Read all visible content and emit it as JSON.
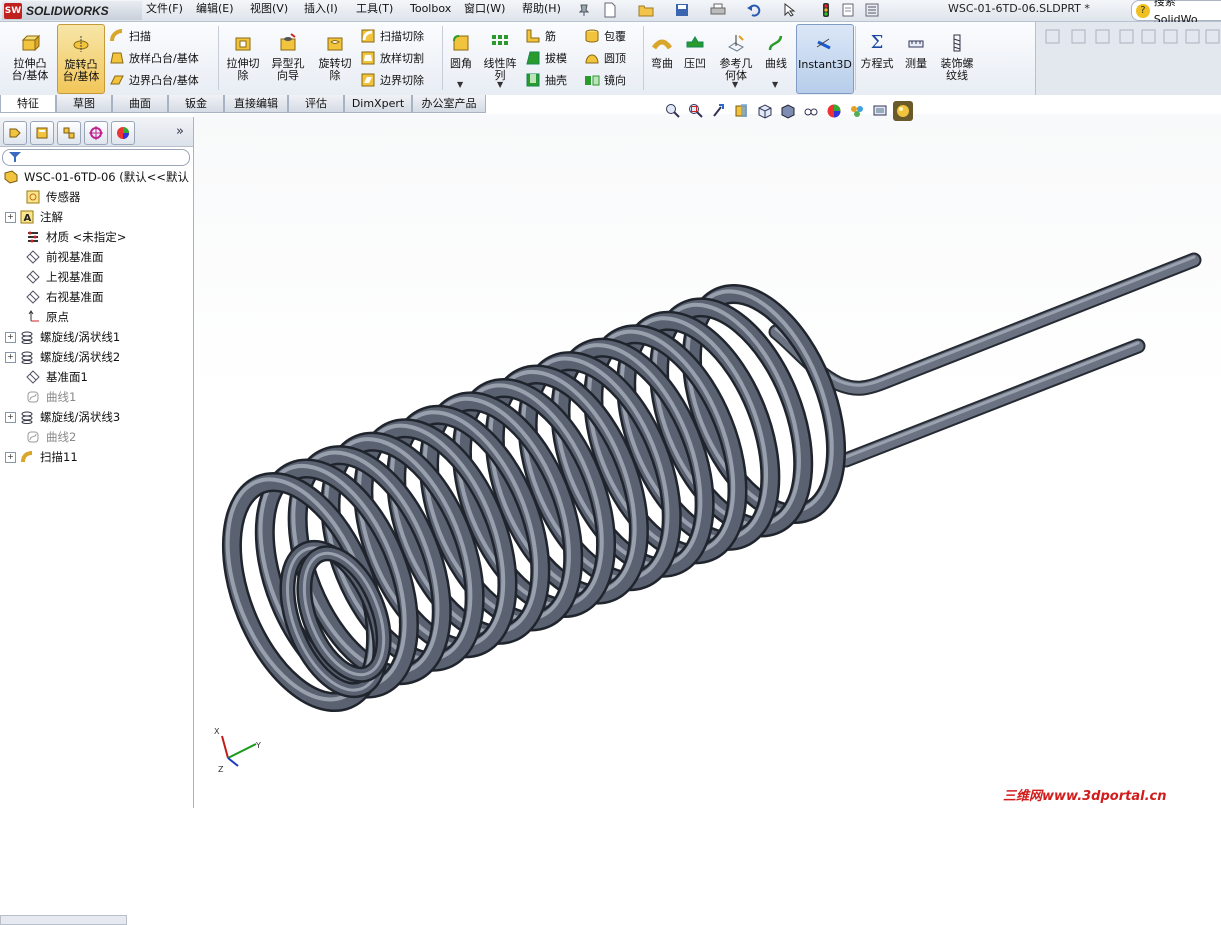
{
  "app": {
    "logo_badge": "SW",
    "logo_text": "SOLIDWORKS",
    "document_title": "WSC-01-6TD-06.SLDPRT *",
    "search_placeholder": "搜索 SolidWo"
  },
  "menubar": [
    "文件(F)",
    "编辑(E)",
    "视图(V)",
    "插入(I)",
    "工具(T)",
    "Toolbox",
    "窗口(W)",
    "帮助(H)"
  ],
  "ribbon": {
    "extrude_boss": "拉伸凸台/基体",
    "revolve_boss": "旋转凸台/基体",
    "sweep": "扫描",
    "loft_boss": "放样凸台/基体",
    "boundary_boss": "边界凸台/基体",
    "extrude_cut": "拉伸切除",
    "hole_wizard": "异型孔向导",
    "revolve_cut": "旋转切除",
    "sweep_cut": "扫描切除",
    "loft_cut": "放样切割",
    "boundary_cut": "边界切除",
    "fillet": "圆角",
    "linear_pattern": "线性阵列",
    "rib": "筋",
    "draft": "拔模",
    "shell": "抽壳",
    "wrap": "包覆",
    "dome": "圆顶",
    "mirror": "镜向",
    "flex": "弯曲",
    "indent": "压凹",
    "ref_geometry": "参考几何体",
    "curves": "曲线",
    "instant3d": "Instant3D",
    "equations": "方程式",
    "measure": "测量",
    "cosmetic_thread": "装饰螺纹线"
  },
  "tabs": [
    "特征",
    "草图",
    "曲面",
    "钣金",
    "直接编辑",
    "评估",
    "DimXpert",
    "办公室产品"
  ],
  "active_tab": "特征",
  "feature_tree": {
    "root": "WSC-01-6TD-06 (默认<<默认",
    "items": [
      {
        "label": "传感器",
        "icon": "sensor-icon",
        "expandable": false,
        "dim": false
      },
      {
        "label": "注解",
        "icon": "annotation-icon",
        "expandable": true,
        "dim": false
      },
      {
        "label": "材质 <未指定>",
        "icon": "material-icon",
        "expandable": false,
        "dim": false
      },
      {
        "label": "前视基准面",
        "icon": "plane-icon",
        "expandable": false,
        "dim": false
      },
      {
        "label": "上视基准面",
        "icon": "plane-icon",
        "expandable": false,
        "dim": false
      },
      {
        "label": "右视基准面",
        "icon": "plane-icon",
        "expandable": false,
        "dim": false
      },
      {
        "label": "原点",
        "icon": "origin-icon",
        "expandable": false,
        "dim": false
      },
      {
        "label": "螺旋线/涡状线1",
        "icon": "helix-icon",
        "expandable": true,
        "dim": false
      },
      {
        "label": "螺旋线/涡状线2",
        "icon": "helix-icon",
        "expandable": true,
        "dim": false
      },
      {
        "label": "基准面1",
        "icon": "plane-icon",
        "expandable": false,
        "dim": false
      },
      {
        "label": "曲线1",
        "icon": "curve-icon",
        "expandable": false,
        "dim": true
      },
      {
        "label": "螺旋线/涡状线3",
        "icon": "helix-icon",
        "expandable": true,
        "dim": false
      },
      {
        "label": "曲线2",
        "icon": "curve-icon",
        "expandable": false,
        "dim": true
      },
      {
        "label": "扫描11",
        "icon": "sweep-icon",
        "expandable": true,
        "dim": false
      }
    ]
  },
  "triad": {
    "x": "X",
    "y": "Y",
    "z": "Z"
  },
  "watermark": "三维网www.3dportal.cn",
  "colors": {
    "spring": "#5a6272",
    "accent": "#f2c65a",
    "watermark": "#d21c1c"
  }
}
